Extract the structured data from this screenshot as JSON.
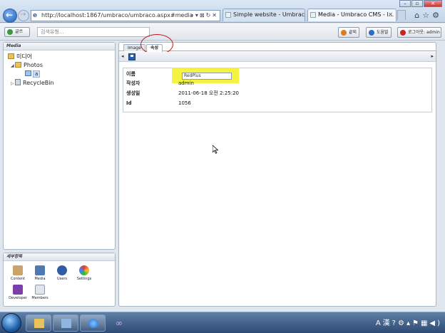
{
  "browser": {
    "address": "http://localhost:1867/umbraco/umbraco.aspx#media",
    "tabs": [
      {
        "label": "Simple website - Umbraco C..."
      },
      {
        "label": "Media - Umbraco CMS - l..."
      }
    ]
  },
  "umbraco_bar": {
    "create_label": "글쓰",
    "search_placeholder": "검색유형...",
    "exit_label": "끝외",
    "help_label": "도움말",
    "logout_label": "로그아웃: admin"
  },
  "tree": {
    "header": "Media",
    "root": "미디어",
    "photos": "Photos",
    "selected_item": "a",
    "recycle": "RecycleBin"
  },
  "sections": {
    "header": "세부항목",
    "items": [
      {
        "label": "Content"
      },
      {
        "label": "Media"
      },
      {
        "label": "Users"
      },
      {
        "label": "Settings"
      },
      {
        "label": "Developer"
      },
      {
        "label": "Members"
      }
    ]
  },
  "content": {
    "tabs": [
      {
        "label": "Image"
      },
      {
        "label": "속성"
      }
    ],
    "properties": [
      {
        "label": "이름",
        "value": "RedPlus"
      },
      {
        "label": "작성자",
        "value": "admin"
      },
      {
        "label": "생성일",
        "value": "2011-06-18 오전 2:25:20"
      },
      {
        "label": "Id",
        "value": "1056"
      }
    ]
  },
  "colors": {
    "highlight": "#f2f21e",
    "annotation_circle": "#c0181c"
  }
}
